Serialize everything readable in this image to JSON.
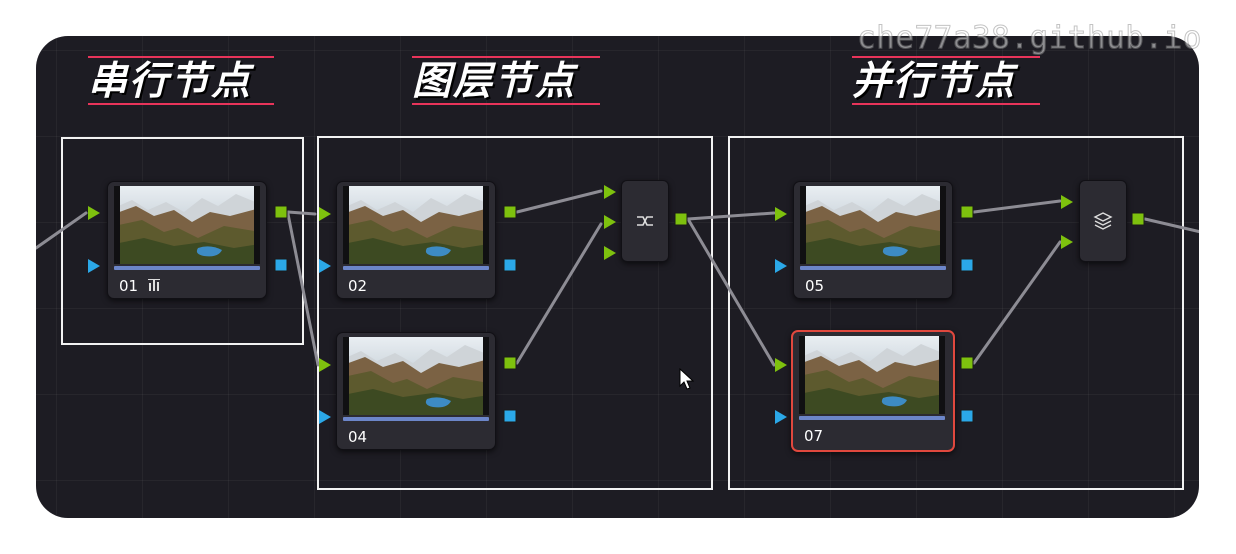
{
  "watermark": "che77a38.github.io",
  "headings": {
    "serial": "串行节点",
    "layer": "图层节点",
    "parallel": "并行节点"
  },
  "nodes": {
    "n01": "01",
    "n02": "02",
    "n04": "04",
    "n05": "05",
    "n07": "07"
  },
  "mixers": {
    "layer_mixer": "layer-mixer-icon",
    "parallel_mixer": "parallel-mixer-icon"
  },
  "colors": {
    "rgb_input": "#7ec10e",
    "key_input": "#2ba8e8",
    "selected_outline": "#e0483e",
    "heading_rule": "#e8345a"
  }
}
